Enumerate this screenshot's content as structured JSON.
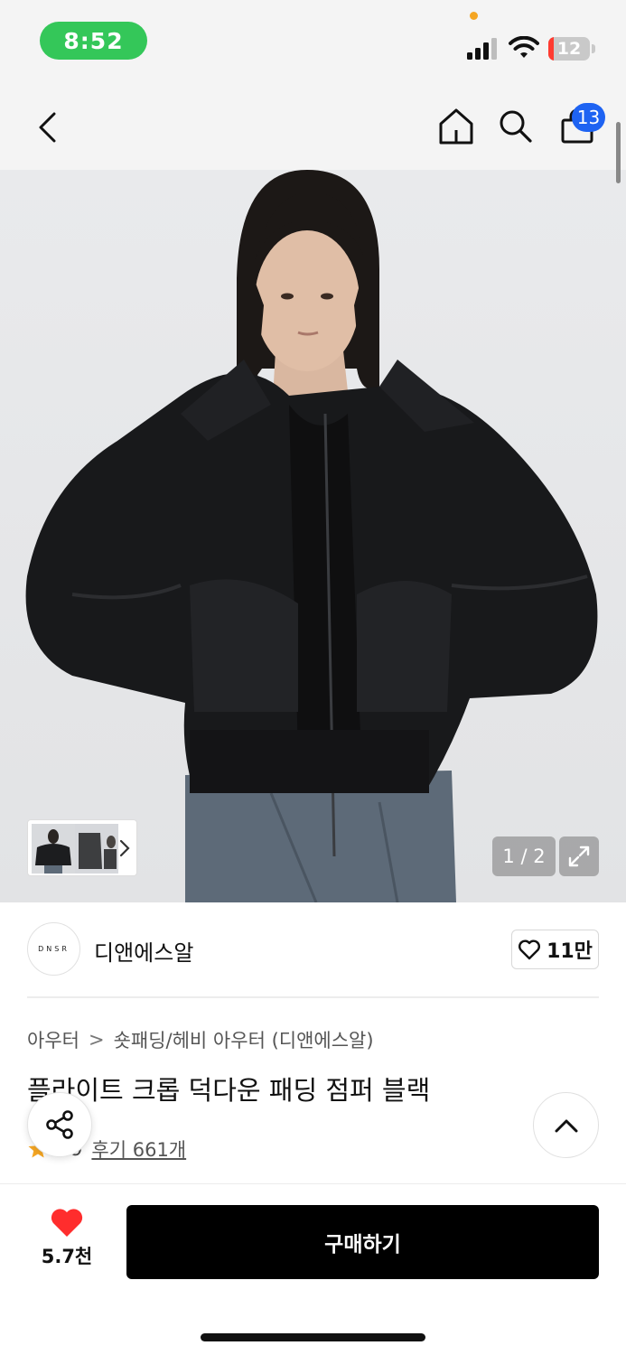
{
  "status_bar": {
    "time": "8:52",
    "battery": "12",
    "icons": [
      "signal-icon",
      "wifi-icon",
      "battery-icon"
    ]
  },
  "header": {
    "icons": [
      "back-icon",
      "home-icon",
      "search-icon",
      "cart-icon"
    ],
    "cart_count": "13"
  },
  "gallery": {
    "counter": "1 / 2",
    "current_image": 1,
    "total_images": 2
  },
  "brand": {
    "logo_text": "DNSR",
    "name": "디앤에스알",
    "likes": "11만"
  },
  "product": {
    "breadcrumb": [
      "아우터",
      "숏패딩/헤비 아우터 (디앤에스알)"
    ],
    "breadcrumb_separator": ">",
    "title": "플라이트 크롭 덕다운 패딩 점퍼 블랙",
    "rating_partial": "4.9",
    "reviews": "후기 661개"
  },
  "bottom_bar": {
    "wish_count": "5.7천",
    "buy_label": "구매하기"
  },
  "colors": {
    "accent_blue": "#1e63f2",
    "status_green": "#34c759",
    "heart_red": "#ff2d2d",
    "star_yellow": "#f5a623",
    "buy_black": "#000000"
  }
}
